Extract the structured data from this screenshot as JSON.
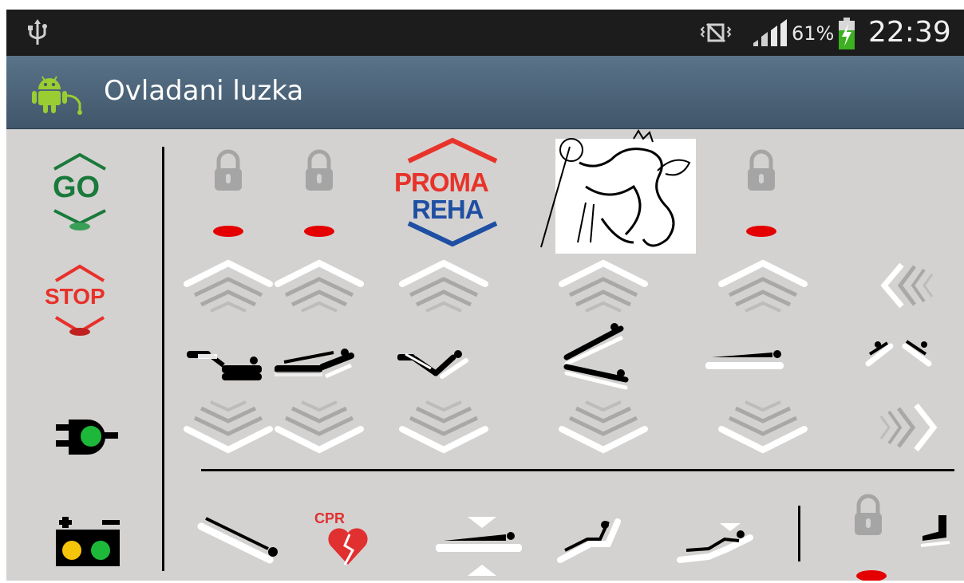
{
  "status_bar": {
    "battery_percent": "61%",
    "time": "22:39",
    "icons": [
      "usb-icon",
      "vibrate-icon",
      "signal-icon",
      "battery-charging-icon"
    ]
  },
  "action_bar": {
    "title": "Ovladani luzka",
    "app_icon": "android-robot-icon"
  },
  "left_panel": {
    "go_label": "GO",
    "stop_label": "STOP",
    "items": [
      "go-button",
      "stop-button",
      "power-plug-button",
      "battery-status"
    ]
  },
  "logos": {
    "proma_line1": "PROMA",
    "proma_line2": "REHA"
  },
  "bottom_row": {
    "cpr_label": "CPR"
  },
  "colors": {
    "go_green": "#1a7a3c",
    "stop_red": "#e8302a",
    "indicator_red": "#e40000",
    "proma_red": "#e8332a",
    "proma_blue": "#1f4fa3",
    "lock_gray": "#a5a5a5",
    "chevron_white": "#ffffff",
    "chevron_gray": "#a8a8a8"
  }
}
